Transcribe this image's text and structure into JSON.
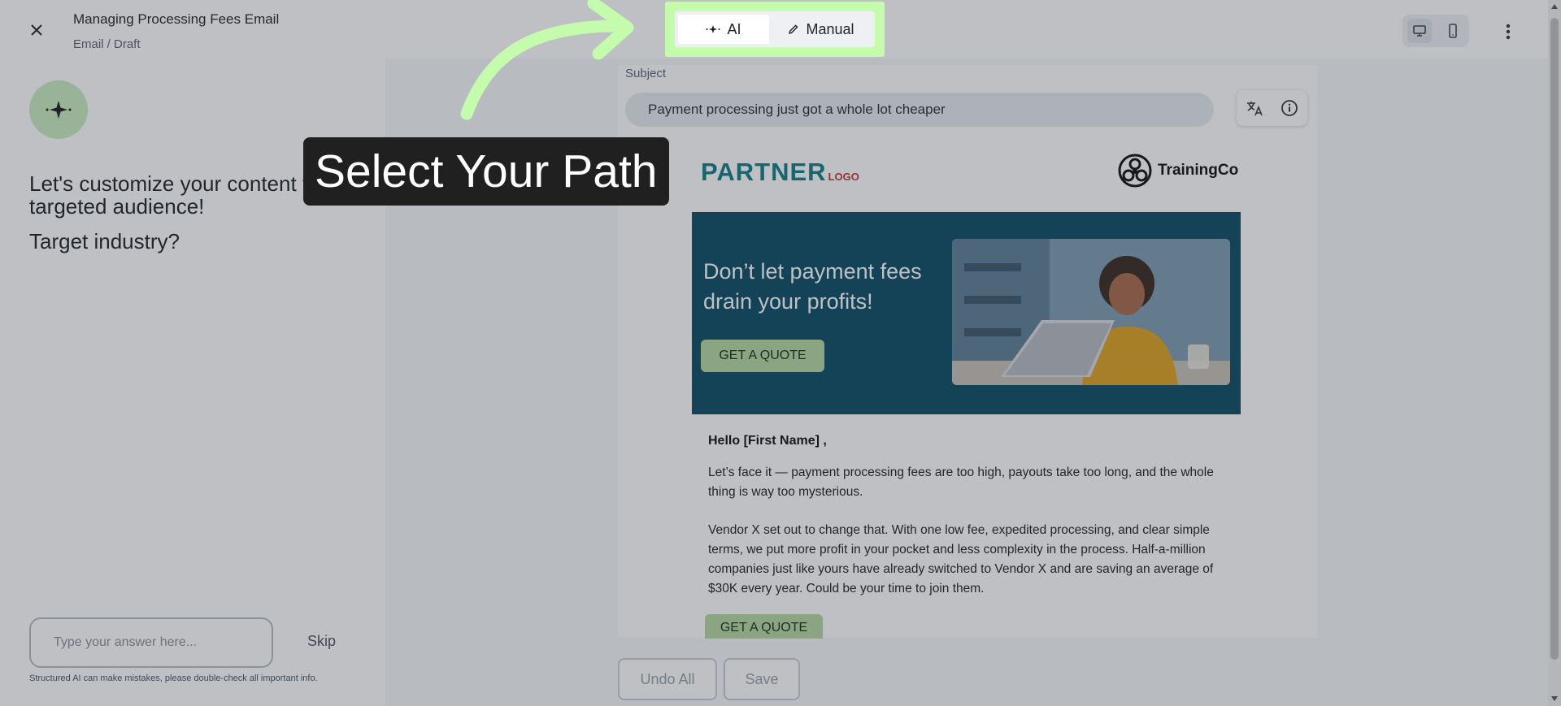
{
  "header": {
    "title": "Managing Processing Fees Email",
    "breadcrumb": "Email / Draft"
  },
  "mode_toggle": {
    "ai_label": "AI",
    "manual_label": "Manual",
    "selected": "AI"
  },
  "callout": {
    "text": "Select Your Path"
  },
  "left_panel": {
    "prompt": "Let's customize your content to a targeted audience!",
    "question": "Target industry?",
    "answer_placeholder": "Type your answer here...",
    "skip_label": "Skip",
    "disclaimer": "Structured AI can make mistakes, please double-check all important info."
  },
  "editor": {
    "subject_label": "Subject",
    "subject_value": "Payment processing just got a whole lot cheaper"
  },
  "email": {
    "partner_logo": "PARTNER",
    "partner_logo_sub": "LOGO",
    "brand_name": "TrainingCo",
    "hero_headline": "Don’t let payment fees drain your profits!",
    "hero_cta": "GET A QUOTE",
    "greeting": "Hello  [First Name] ,",
    "paragraph_1": "Let’s face it — payment processing fees are too high, payouts take too long, and the whole thing is way too mysterious.",
    "paragraph_2": "Vendor X set out to change that. With one low fee, expedited processing, and clear simple terms, we put more profit in your pocket and less complexity in the process. Half-a-million companies just like yours have already switched to Vendor X and are saving an average of $30K every year. Could be your time to join them.",
    "body_cta": "GET A QUOTE"
  },
  "actions": {
    "undo_all": "Undo All",
    "save": "Save"
  },
  "colors": {
    "highlight": "#c4fbad",
    "hero_bg": "#0c4d63",
    "cta_bg": "#b6d9a2",
    "partner_teal": "#0e7f84",
    "partner_red": "#c0392b"
  },
  "icons": [
    "close-icon",
    "sparkle-icon",
    "desktop-icon",
    "mobile-icon",
    "more-vert-icon",
    "translate-icon",
    "info-icon",
    "pencil-icon",
    "recycle-logo-icon"
  ]
}
